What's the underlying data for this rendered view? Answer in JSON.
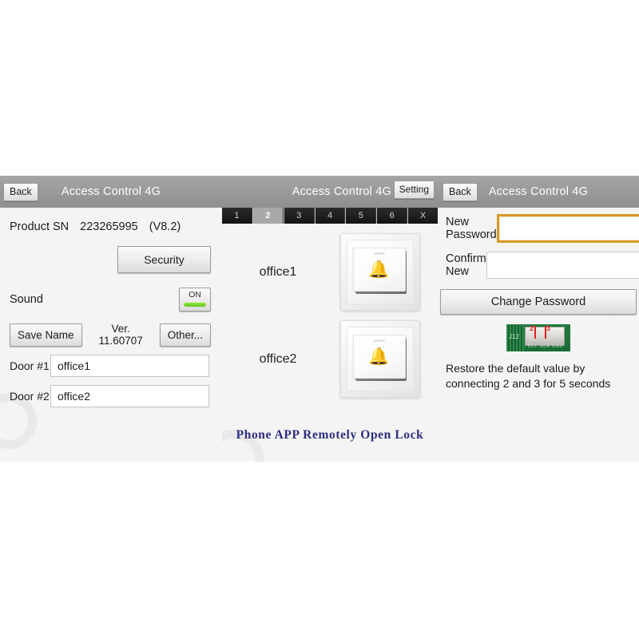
{
  "app": {
    "title": "Access Control 4G",
    "back_label": "Back",
    "setting_label": "Setting"
  },
  "colors": {
    "header_gray": "#9b9b9b",
    "panel_bg": "#f4f4f4",
    "toggle_green": "#7ed321",
    "focus_orange": "#d79a2b",
    "promo_blue": "#2b2f80",
    "pcb_green": "#1a6c35",
    "pcb_marker_red": "#e02020",
    "tab_black": "#141414"
  },
  "panel_left": {
    "title": "Access Control 4G",
    "back_label": "Back",
    "product_sn_label": "Product SN",
    "product_sn_value": "223265995",
    "firmware_version": "(V8.2)",
    "security_button": "Security",
    "sound_label": "Sound",
    "sound_toggle_state": "ON",
    "save_name_button": "Save Name",
    "version_text": "Ver. 11.60707",
    "other_button": "Other...",
    "doors": [
      {
        "label": "Door #1",
        "value": "office1",
        "placeholder": "Door name"
      },
      {
        "label": "Door #2",
        "value": "office2",
        "placeholder": "Door name"
      }
    ]
  },
  "panel_mid": {
    "title": "Access Control 4G",
    "setting_button": "Setting",
    "tabs": [
      {
        "label": "1",
        "selected": false
      },
      {
        "label": "2",
        "selected": true
      },
      {
        "label": "3",
        "selected": false
      },
      {
        "label": "4",
        "selected": false
      },
      {
        "label": "5",
        "selected": false
      },
      {
        "label": "6",
        "selected": false
      },
      {
        "label": "X",
        "selected": false
      }
    ],
    "switches": [
      {
        "name": "office1",
        "icon": "bell-icon"
      },
      {
        "name": "office2",
        "icon": "bell-icon"
      }
    ],
    "promo_text": "Phone APP Remotely Open Lock"
  },
  "panel_right": {
    "title": "Access Control 4G",
    "back_label": "Back",
    "new_password_label": "New Password",
    "new_password_value": "",
    "new_password_placeholder": "",
    "confirm_password_label": "Confirm New",
    "confirm_password_value": "",
    "confirm_password_placeholder": "",
    "change_password_button": "Change Password",
    "pcb": {
      "connector_label": "J12",
      "pin_labels": "SCL SDA GND +12",
      "marker_2": "2",
      "marker_3": "3"
    },
    "restore_text": "Restore the default value by connecting 2 and 3 for 5 seconds"
  }
}
